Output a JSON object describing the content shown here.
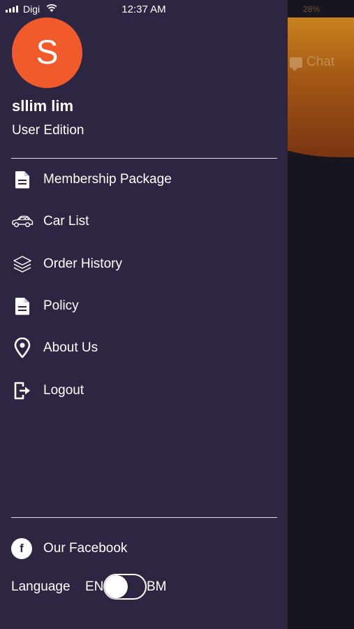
{
  "status_bar": {
    "carrier": "Digi",
    "time": "12:37 AM",
    "battery": "28%"
  },
  "background": {
    "chat_label": "Chat"
  },
  "profile": {
    "avatar_initial": "S",
    "avatar_color": "#f15a2a",
    "name": "sllim lim",
    "edition": "User Edition"
  },
  "menu": {
    "items": [
      {
        "label": "Membership Package",
        "icon": "document-icon"
      },
      {
        "label": "Car List",
        "icon": "car-icon"
      },
      {
        "label": "Order History",
        "icon": "layers-icon"
      },
      {
        "label": "Policy",
        "icon": "document-icon"
      },
      {
        "label": "About Us",
        "icon": "location-pin-icon"
      },
      {
        "label": "Logout",
        "icon": "logout-icon"
      }
    ]
  },
  "footer": {
    "facebook_label": "Our Facebook",
    "language_label": "Language",
    "lang_left": "EN",
    "lang_right": "BM",
    "language_selected": "EN"
  },
  "colors": {
    "drawer_bg": "#2c2642",
    "accent": "#f15a2a"
  }
}
